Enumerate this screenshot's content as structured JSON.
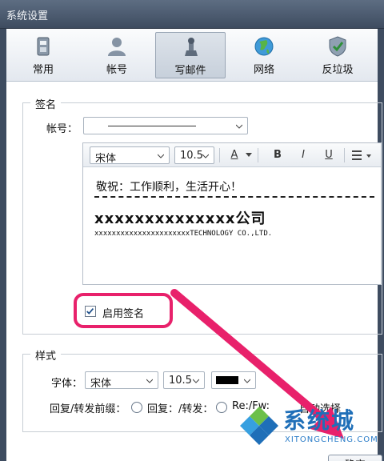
{
  "window": {
    "title": "系统设置"
  },
  "toolbar": {
    "items": [
      {
        "label": "常用",
        "icon": "general-icon"
      },
      {
        "label": "帐号",
        "icon": "account-icon"
      },
      {
        "label": "写邮件",
        "icon": "compose-icon",
        "active": true
      },
      {
        "label": "网络",
        "icon": "network-globe-icon"
      },
      {
        "label": "反垃圾",
        "icon": "antispam-shield-icon"
      }
    ]
  },
  "signature": {
    "legend": "签名",
    "account_label": "帐号：",
    "account_value": "",
    "editor": {
      "font": "宋体",
      "size": "10.5",
      "bold": "B",
      "italic": "I",
      "underline": "U",
      "font_color": "A",
      "content_line1": "敬祝：工作顺利，生活开心！",
      "content_line2": "xxxxxxxxxxxxxx公司",
      "content_line3": "xxxxxxxxxxxxxxxxxxxxxxTECHNOLOGY CO.,LTD."
    },
    "enable_label": "启用签名",
    "enable_checked": true
  },
  "style": {
    "legend": "样式",
    "font_label": "字体：",
    "font_value": "宋体",
    "size_value": "10.5",
    "color_value": "#000000",
    "prefix_label": "回复/转发前缀：",
    "option1": "回复：/转发：",
    "option2": "Re:/Fw:",
    "option3": "自动选择"
  },
  "footer": {
    "ok_label": "确定"
  },
  "watermark": {
    "text": "系统城",
    "url": "XITONGCHENG.COM"
  },
  "colors": {
    "highlight": "#e8216b",
    "arrow": "#e8216b"
  }
}
